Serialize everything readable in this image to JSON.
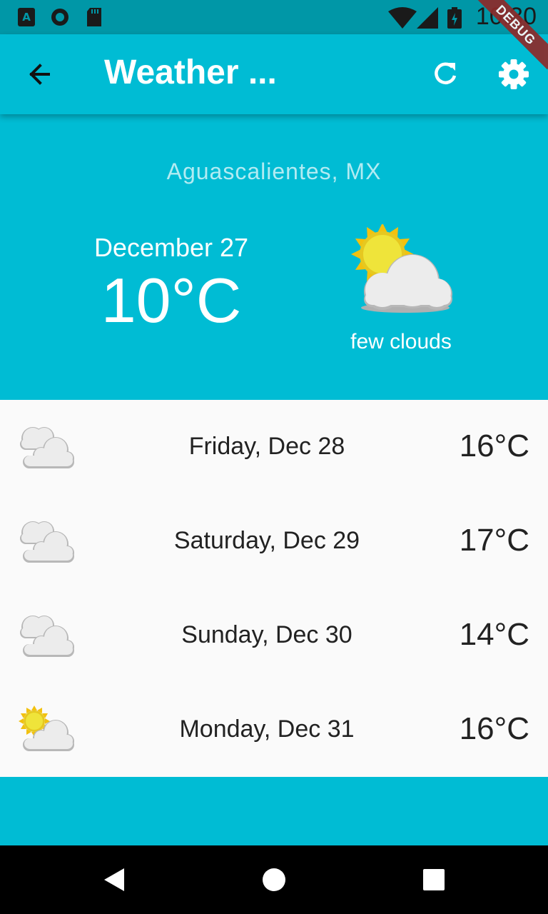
{
  "status_bar": {
    "time": "10:30"
  },
  "app_bar": {
    "title": "Weather ..."
  },
  "debug_banner": "DEBUG",
  "current": {
    "location": "Aguascalientes,  MX",
    "date": "December 27",
    "temperature": "10°C",
    "description": "few clouds",
    "icon": "few-clouds-icon"
  },
  "forecast": [
    {
      "day": "Friday, Dec 28",
      "temp": "16°C",
      "icon": "clouds-icon"
    },
    {
      "day": "Saturday, Dec 29",
      "temp": "17°C",
      "icon": "clouds-icon"
    },
    {
      "day": "Sunday, Dec 30",
      "temp": "14°C",
      "icon": "clouds-icon"
    },
    {
      "day": "Monday, Dec 31",
      "temp": "16°C",
      "icon": "few-clouds-icon"
    }
  ],
  "colors": {
    "primary": "#00bcd4",
    "status_bar": "#0097a7",
    "list_bg": "#fafafa"
  }
}
